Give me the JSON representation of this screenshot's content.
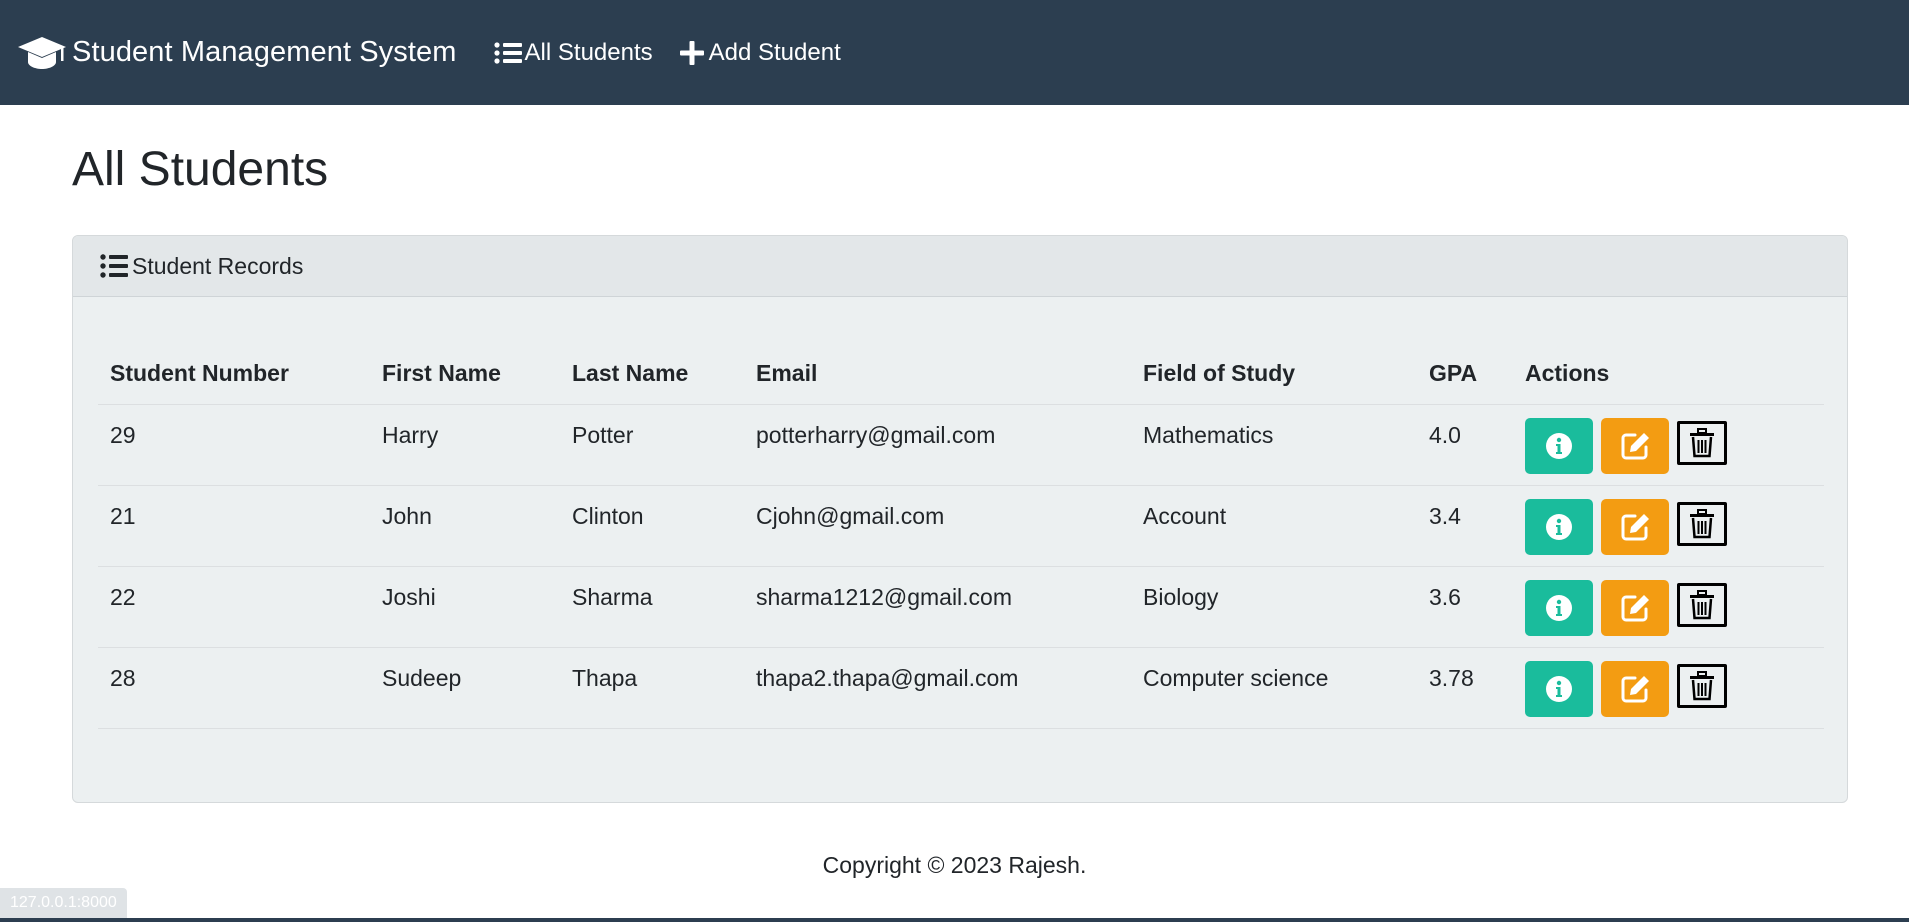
{
  "navbar": {
    "brand": "Student Management System",
    "links": [
      {
        "label": "All Students",
        "icon": "list-icon"
      },
      {
        "label": "Add Student",
        "icon": "plus-icon"
      }
    ]
  },
  "page": {
    "title": "All Students"
  },
  "card": {
    "header": "Student Records",
    "columns": [
      "Student Number",
      "First Name",
      "Last Name",
      "Email",
      "Field of Study",
      "GPA",
      "Actions"
    ],
    "rows": [
      {
        "number": "29",
        "first": "Harry",
        "last": "Potter",
        "email": "potterharry@gmail.com",
        "field": "Mathematics",
        "gpa": "4.0"
      },
      {
        "number": "21",
        "first": "John",
        "last": "Clinton",
        "email": "Cjohn@gmail.com",
        "field": "Account",
        "gpa": "3.4"
      },
      {
        "number": "22",
        "first": "Joshi",
        "last": "Sharma",
        "email": "sharma1212@gmail.com",
        "field": "Biology",
        "gpa": "3.6"
      },
      {
        "number": "28",
        "first": "Sudeep",
        "last": "Thapa",
        "email": "thapa2.thapa@gmail.com",
        "field": "Computer science",
        "gpa": "3.78"
      }
    ],
    "action_icons": [
      "info-icon",
      "edit-icon",
      "trash-icon"
    ]
  },
  "footer": {
    "copyright": "Copyright © 2023 Rajesh."
  },
  "status_bar": {
    "url": "127.0.0.1:8000"
  },
  "colors": {
    "navbar": "#2c3e50",
    "info_button": "#1abc9c",
    "edit_button": "#f39c12",
    "card_background": "#ecf0f1"
  }
}
